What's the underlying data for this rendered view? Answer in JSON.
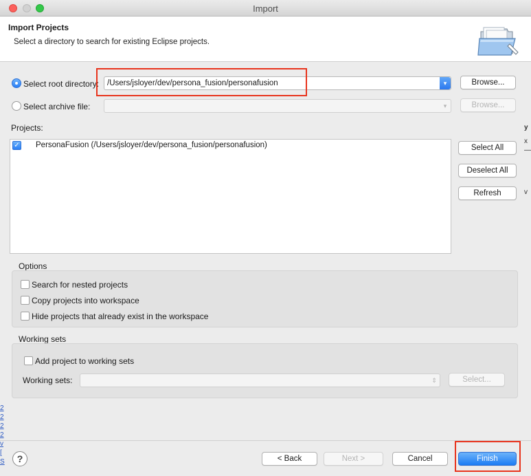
{
  "window": {
    "title": "Import"
  },
  "header": {
    "title": "Import Projects",
    "description": "Select a directory to search for existing Eclipse projects."
  },
  "source": {
    "root_directory": {
      "label": "Select root directory:",
      "selected": true,
      "value": "/Users/jsloyer/dev/persona_fusion/personafusion",
      "browse_label": "Browse..."
    },
    "archive_file": {
      "label": "Select archive file:",
      "selected": false,
      "value": "",
      "browse_label": "Browse..."
    }
  },
  "projects": {
    "label": "Projects:",
    "items": [
      {
        "checked": true,
        "label": "PersonaFusion (/Users/jsloyer/dev/persona_fusion/personafusion)"
      }
    ],
    "select_all_label": "Select All",
    "deselect_all_label": "Deselect All",
    "refresh_label": "Refresh"
  },
  "options": {
    "title": "Options",
    "items": [
      {
        "label": "Search for nested projects",
        "checked": false
      },
      {
        "label": "Copy projects into workspace",
        "checked": false
      },
      {
        "label": "Hide projects that already exist in the workspace",
        "checked": false
      }
    ]
  },
  "working_sets": {
    "title": "Working sets",
    "add_label": "Add project to working sets",
    "add_checked": false,
    "sets_label": "Working sets:",
    "sets_value": "",
    "select_label": "Select..."
  },
  "footer": {
    "help_glyph": "?",
    "back_label": "< Back",
    "next_label": "Next >",
    "cancel_label": "Cancel",
    "finish_label": "Finish"
  },
  "background_fragments": {
    "right": [
      "y",
      "x",
      "—",
      "v"
    ],
    "left": [
      "2",
      "2",
      "2",
      "2",
      "v",
      "[",
      "S"
    ]
  },
  "colors": {
    "accent": "#2a7ff5",
    "highlight": "#e8331c",
    "window_bg": "#ececec"
  },
  "icons": {
    "radio_selected": "radio-selected-icon",
    "folder": "open-folder-icon",
    "help": "help-icon",
    "checkmark": "checkmark-icon",
    "dropdown": "dropdown-arrow-icon"
  }
}
